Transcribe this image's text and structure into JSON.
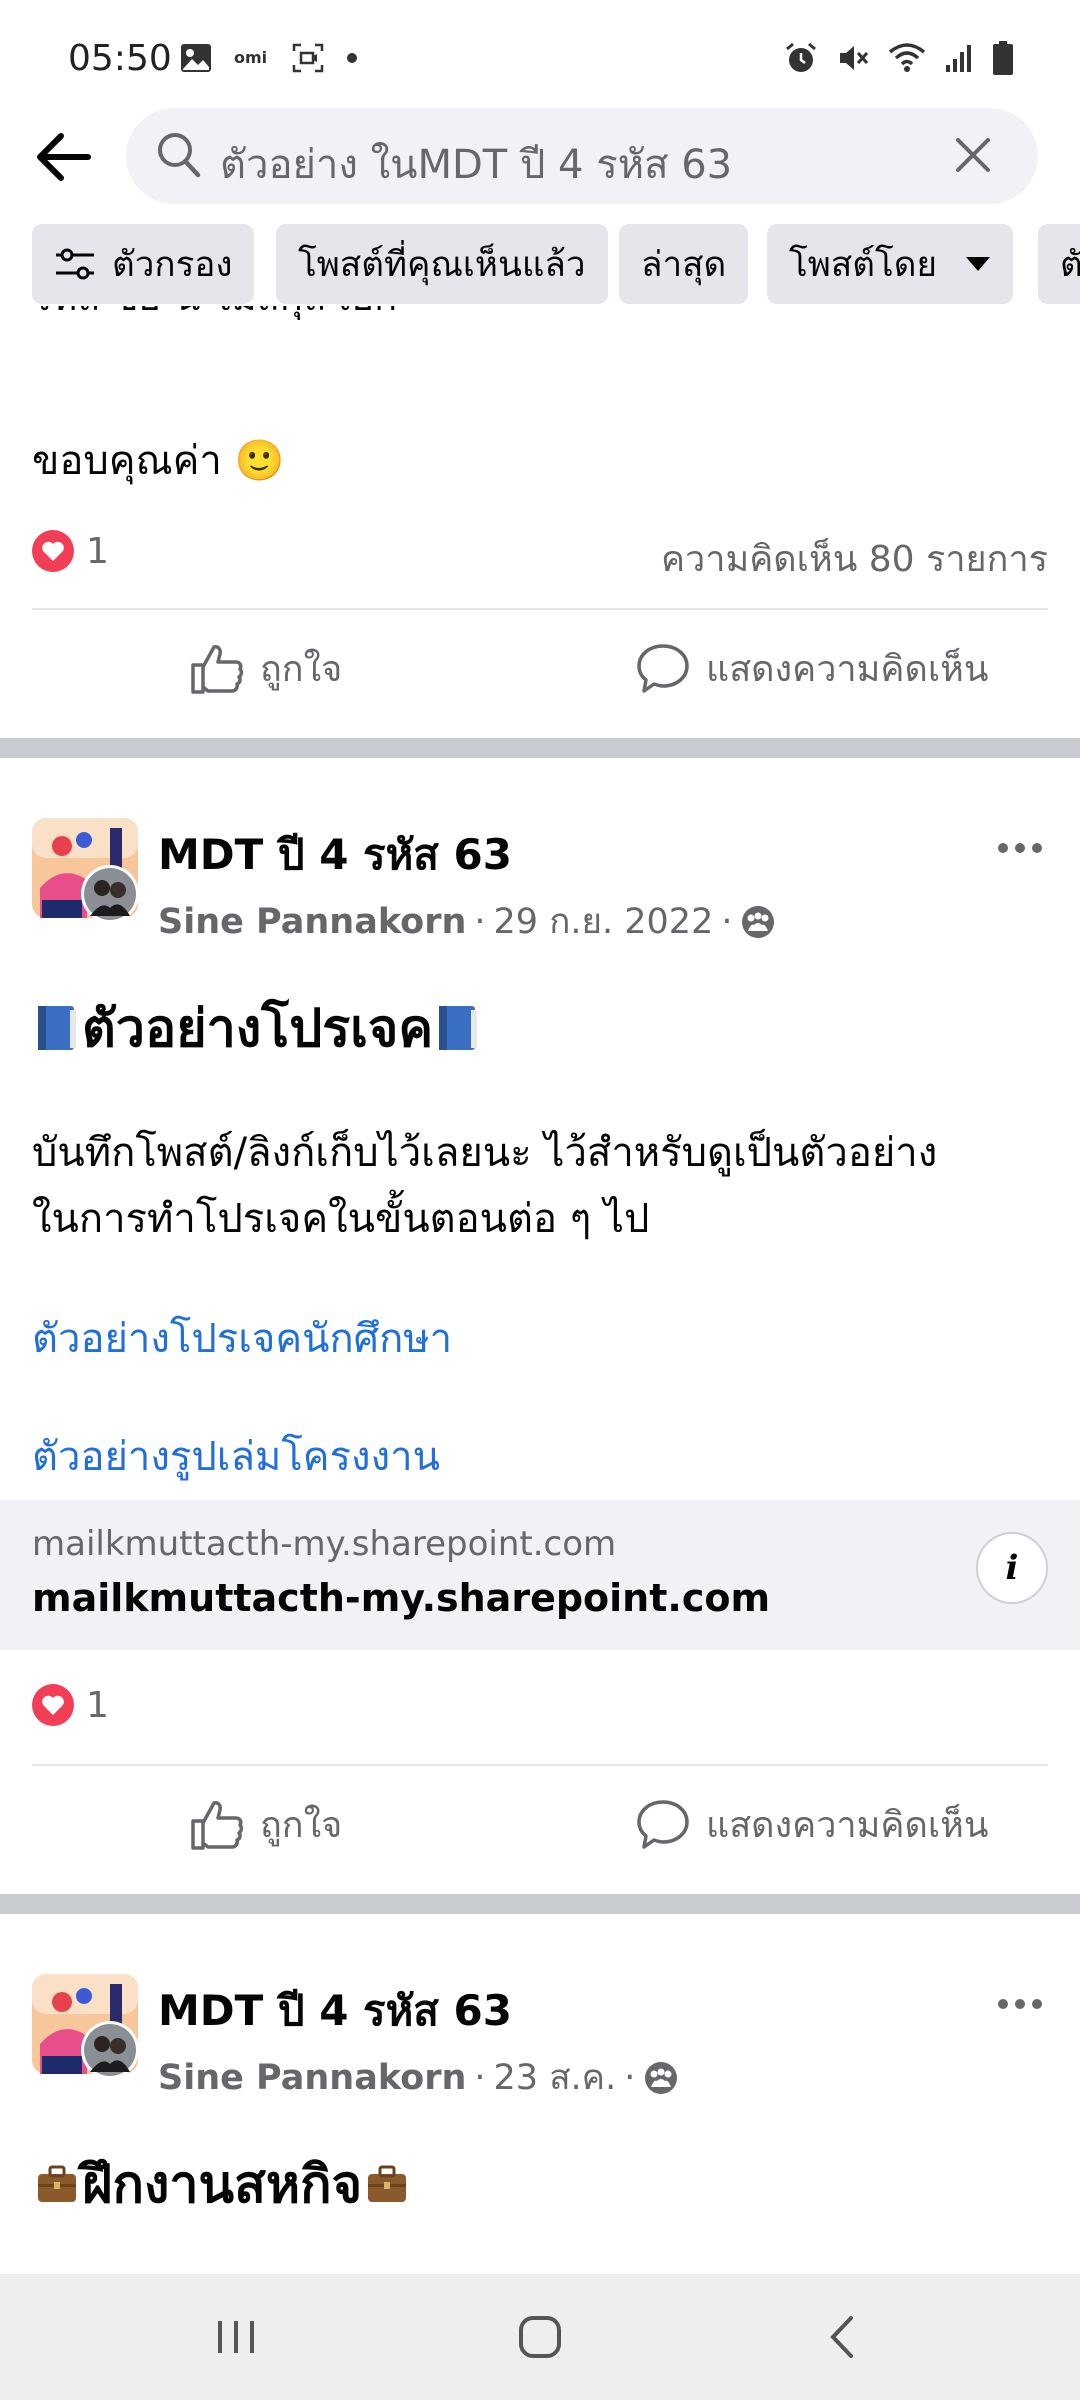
{
  "status_bar": {
    "time": "05:50",
    "left_icons": [
      "image-icon",
      "omi-icon",
      "screen-record-icon",
      "dot-icon"
    ],
    "right_icons": [
      "alarm-icon",
      "mute-icon",
      "wifi-icon",
      "signal-icon",
      "battery-icon"
    ]
  },
  "search": {
    "query": "ตัวอย่าง ในMDT ปี 4 รหัส 63"
  },
  "filters": [
    {
      "label": "ตัวกรอง"
    },
    {
      "label": "โพสต์ที่คุณเห็นแล้ว"
    },
    {
      "label": "ล่าสุด"
    },
    {
      "label": "โพสต์โดย"
    },
    {
      "label": "ตั"
    }
  ],
  "previous_post": {
    "cut_text": "รหัส ชีย-น ไม่สกุล เอก",
    "text": "ขอบคุณค่า 🙂",
    "reaction_count": "1",
    "comments": "ความคิดเห็น 80 รายการ",
    "like_label": "ถูกใจ",
    "comment_label": "แสดงความคิดเห็น"
  },
  "post1": {
    "group": "MDT ปี 4 รหัส 63",
    "author": "Sine Pannakorn",
    "date": "29 ก.ย. 2022",
    "title": "ตัวอย่างโปรเจค",
    "body_line1": "บันทึกโพสต์/ลิงก์เก็บไว้เลยนะ ไว้สำหรับดูเป็นตัวอย่าง",
    "body_line2": "ในการทำโปรเจคในขั้นตอนต่อ ๆ ไป",
    "link1": "ตัวอย่างโปรเจคนักศึกษา",
    "link2": "ตัวอย่างรูปเล่มโครงงาน",
    "preview_domain_small": "mailkmuttacth-my.sharepoint.com",
    "preview_domain_big": "mailkmuttacth-my.sharepoint.com",
    "info": "i",
    "reaction_count": "1",
    "like_label": "ถูกใจ",
    "comment_label": "แสดงความคิดเห็น"
  },
  "post2": {
    "group": "MDT ปี 4 รหัส 63",
    "author": "Sine Pannakorn",
    "date": "23 ส.ค.",
    "title": "ฝึกงานสหกิจ"
  },
  "colors": {
    "link": "#216fdb",
    "heart": "#f33e58",
    "separator": "#c9ccd1",
    "chip": "#e4e6eb"
  }
}
